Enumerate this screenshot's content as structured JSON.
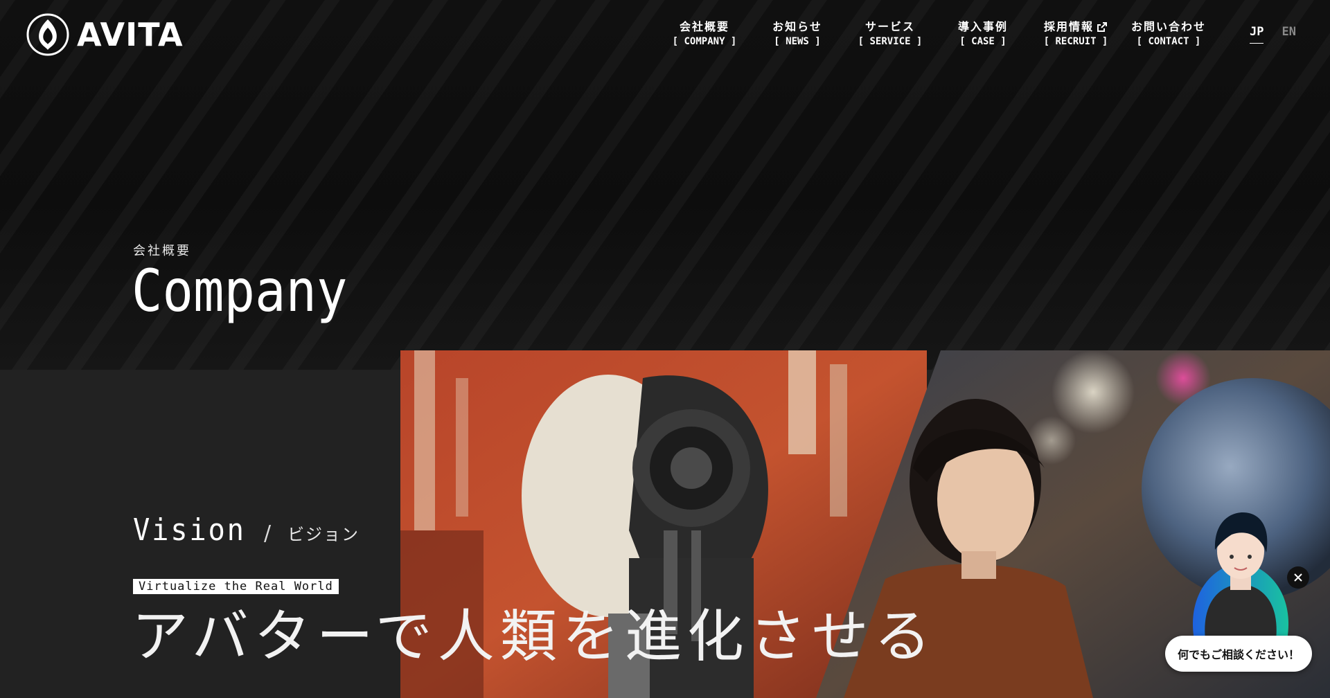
{
  "brand": {
    "name": "AVITA"
  },
  "nav": {
    "items": [
      {
        "ja": "会社概要",
        "en": "[ COMPANY ]"
      },
      {
        "ja": "お知らせ",
        "en": "[ NEWS ]"
      },
      {
        "ja": "サービス",
        "en": "[ SERVICE ]"
      },
      {
        "ja": "導入事例",
        "en": "[ CASE ]"
      },
      {
        "ja": "採用情報",
        "en": "[ RECRUIT ]",
        "icon": "external-link-icon"
      },
      {
        "ja": "お問い合わせ",
        "en": "[ CONTACT ]"
      }
    ]
  },
  "lang": {
    "jp": "JP",
    "en": "EN",
    "active": "JP"
  },
  "page": {
    "subtitle": "会社概要",
    "title": "Company"
  },
  "vision": {
    "title_en": "Vision",
    "separator": "/",
    "title_ja": "ビジョン",
    "tagline": "Virtualize the Real World",
    "headline": "アバターで人類を進化させる"
  },
  "chat": {
    "bubble": "何でもご相談ください！",
    "close_icon": "close-icon"
  },
  "colors": {
    "background": "#0b0b0b",
    "panel": "#222222",
    "text": "#ffffff",
    "accent_muted": "#8a8a8a"
  }
}
